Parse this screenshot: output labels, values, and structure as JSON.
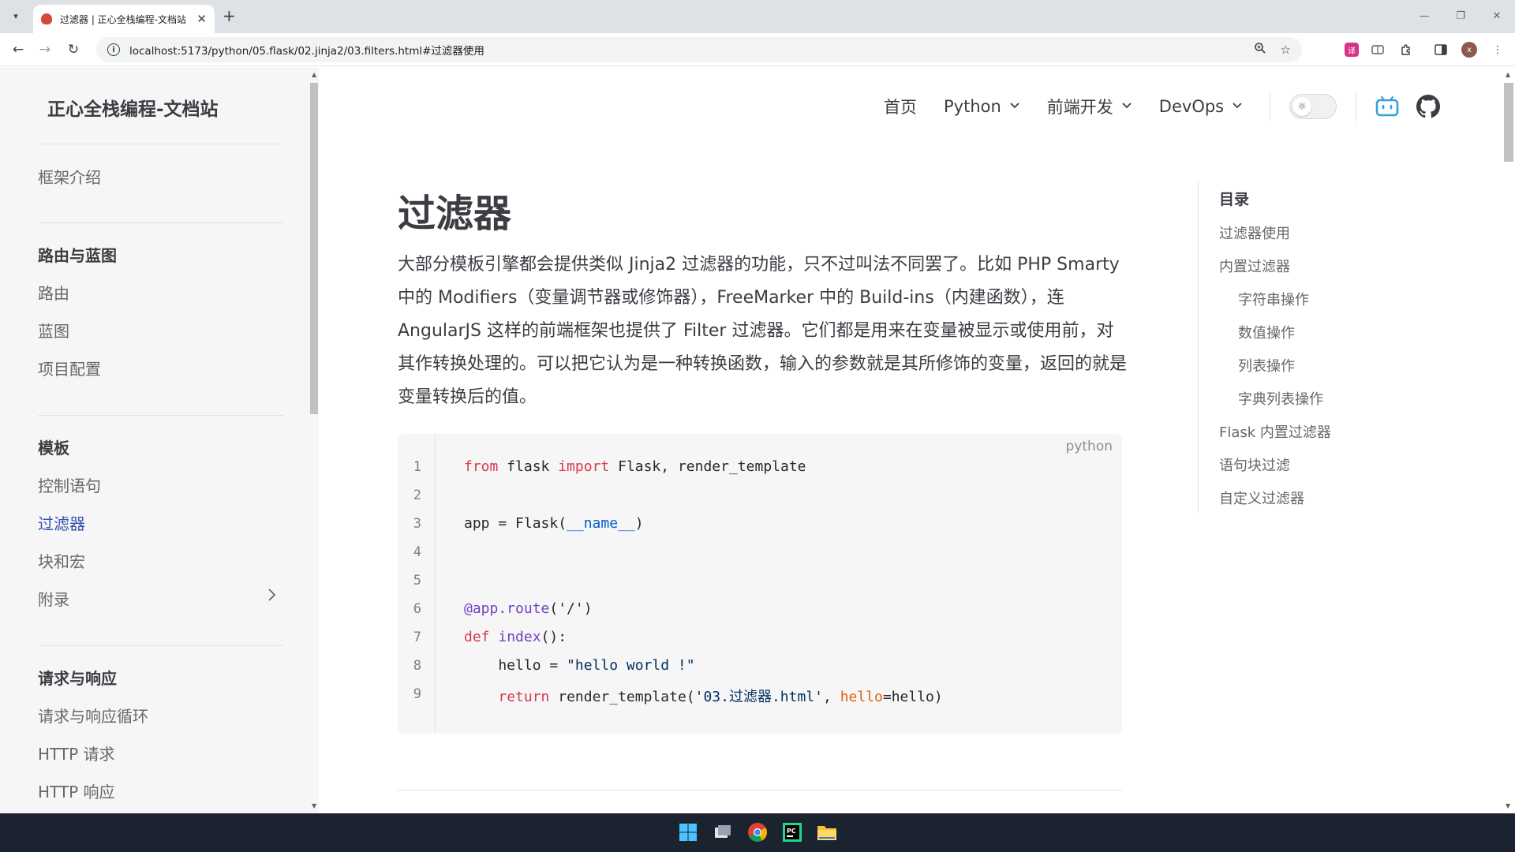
{
  "browser": {
    "tab_title": "过滤器 | 正心全栈编程-文档站",
    "url": "localhost:5173/python/05.flask/02.jinja2/03.filters.html#过滤器使用"
  },
  "site": {
    "title": "正心全栈编程-文档站"
  },
  "sidebar": {
    "intro": "框架介绍",
    "sections": [
      {
        "heading": "路由与蓝图",
        "items": [
          "路由",
          "蓝图",
          "项目配置"
        ]
      },
      {
        "heading": "模板",
        "items": [
          "控制语句",
          "过滤器",
          "块和宏",
          "附录"
        ]
      },
      {
        "heading": "请求与响应",
        "items": [
          "请求与响应循环",
          "HTTP 请求",
          "HTTP 响应"
        ]
      }
    ]
  },
  "nav": {
    "home": "首页",
    "python": "Python",
    "frontend": "前端开发",
    "devops": "DevOps"
  },
  "article": {
    "title": "过滤器",
    "paragraph": "大部分模板引擎都会提供类似 Jinja2 过滤器的功能，只不过叫法不同罢了。比如 PHP Smarty 中的 Modifiers（变量调节器或修饰器），FreeMarker 中的 Build-ins（内建函数），连 AngularJS 这样的前端框架也提供了 Filter 过滤器。它们都是用来在变量被显示或使用前，对其作转换处理的。可以把它认为是一种转换函数，输入的参数就是其所修饰的变量，返回的就是变量转换后的值。"
  },
  "code": {
    "language": "python",
    "line_numbers": [
      "1",
      "2",
      "3",
      "4",
      "5",
      "6",
      "7",
      "8",
      "9"
    ],
    "tokens": {
      "l1_from": "from",
      "l1_a": " flask ",
      "l1_import": "import",
      "l1_b": " Flask, render_template",
      "l3_a": "app = Flask(",
      "l3_name": "__name__",
      "l3_b": ")",
      "l6_deco": "@app.route",
      "l6_b": "('/')",
      "l7_def": "def",
      "l7_sp": " ",
      "l7_fn": "index",
      "l7_b": "():",
      "l8_a": "    hello = ",
      "l8_str": "\"hello world !\"",
      "l9_ind": "    ",
      "l9_return": "return",
      "l9_a": " render_template(",
      "l9_str": "'03.过滤器.html'",
      "l9_b": ", ",
      "l9_arg": "hello",
      "l9_c": "=hello)"
    }
  },
  "toc": {
    "title": "目录",
    "items": [
      "过滤器使用",
      "内置过滤器",
      "字符串操作",
      "数值操作",
      "列表操作",
      "字典列表操作",
      "Flask 内置过滤器",
      "语句块过滤",
      "自定义过滤器"
    ]
  },
  "colors": {
    "accent": "#3451b2",
    "sidebar_bg": "#f6f6f7",
    "code_bg": "#f6f6f7",
    "taskbar_bg": "#1c2330"
  }
}
